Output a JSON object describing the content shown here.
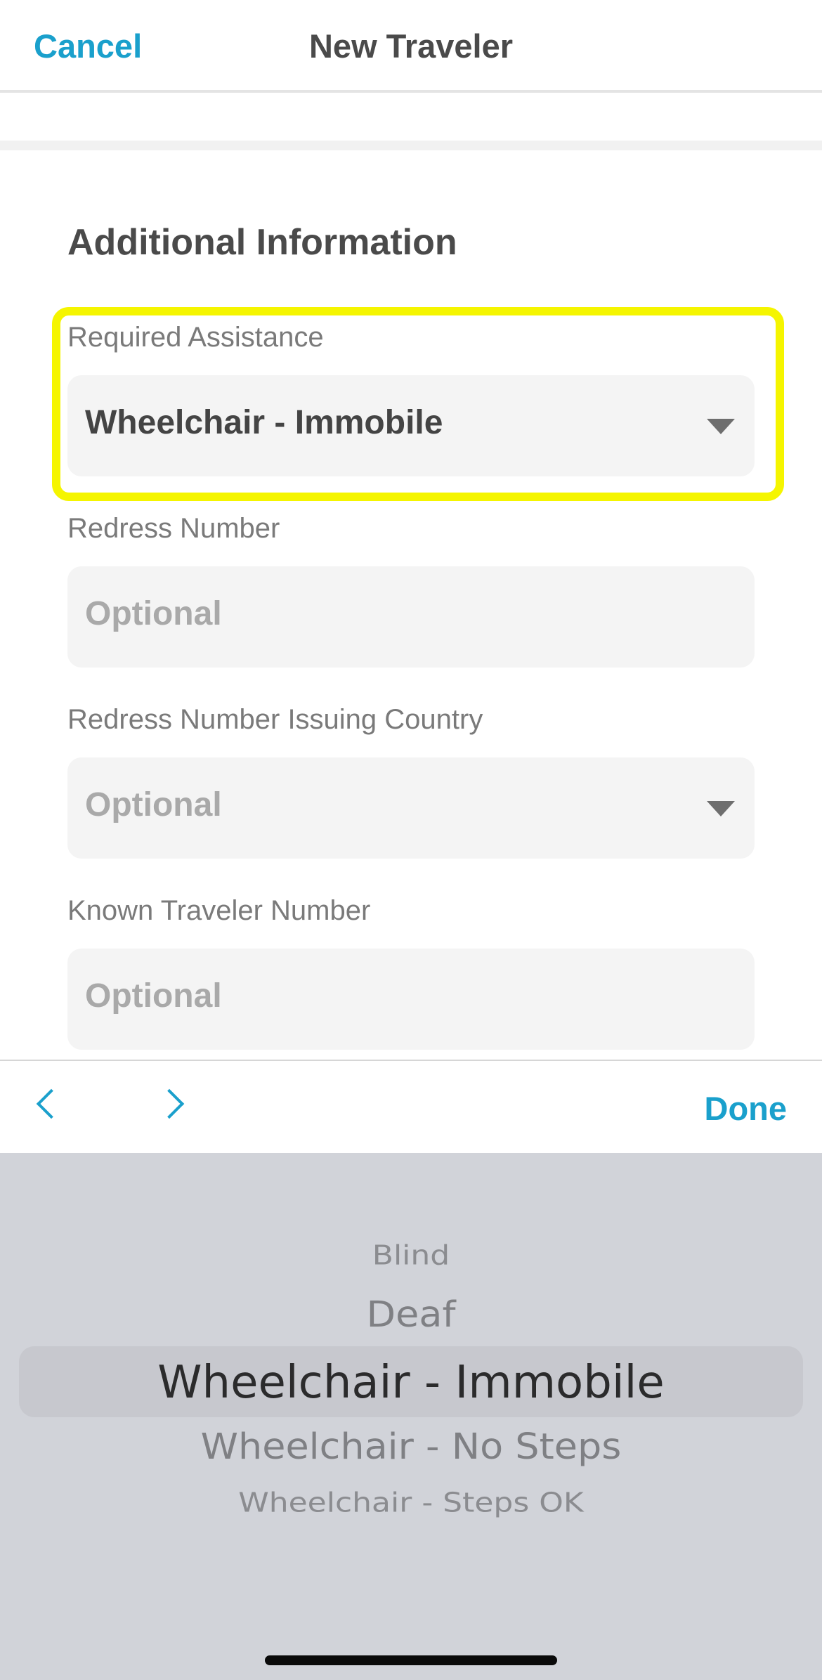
{
  "header": {
    "cancel_label": "Cancel",
    "title": "New Traveler"
  },
  "form": {
    "section_title": "Additional Information",
    "required_assistance": {
      "label": "Required Assistance",
      "value": "Wheelchair - Immobile"
    },
    "redress_number": {
      "label": "Redress Number",
      "placeholder": "Optional"
    },
    "redress_country": {
      "label": "Redress Number Issuing Country",
      "placeholder": "Optional"
    },
    "known_traveler": {
      "label": "Known Traveler Number",
      "placeholder": "Optional"
    }
  },
  "toolbar": {
    "done_label": "Done"
  },
  "picker": {
    "options": [
      "Blind",
      "Deaf",
      "Wheelchair - Immobile",
      "Wheelchair - No Steps",
      "Wheelchair - Steps OK"
    ],
    "selected": "Wheelchair - Immobile"
  },
  "colors": {
    "accent": "#1aa0cc",
    "highlight": "#f5f500",
    "picker_bg": "#d1d3d9"
  }
}
